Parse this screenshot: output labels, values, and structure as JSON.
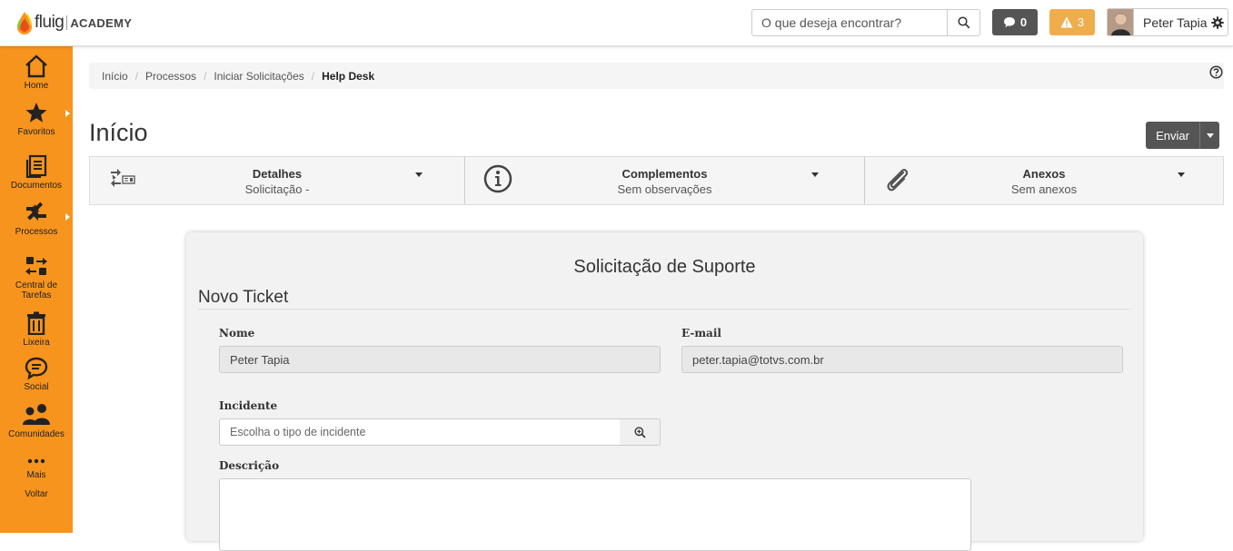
{
  "header": {
    "logo_text": "fluig",
    "logo_academy": "ACADEMY",
    "search_placeholder": "O que deseja encontrar?",
    "messages_count": "0",
    "alerts_count": "3",
    "user_name": "Peter Tapia",
    "colors": {
      "messages": "#555555",
      "alerts": "#f0ad4e",
      "sidebar": "#f7941d"
    }
  },
  "sidebar": {
    "items": [
      {
        "label": "Home",
        "icon": "home-icon"
      },
      {
        "label": "Favoritos",
        "icon": "star-icon"
      },
      {
        "label": "Documentos",
        "icon": "documents-icon"
      },
      {
        "label": "Processos",
        "icon": "processes-icon"
      },
      {
        "label": "Central de Tarefas",
        "icon": "tasks-icon"
      },
      {
        "label": "Lixeira",
        "icon": "trash-icon"
      },
      {
        "label": "Social",
        "icon": "chat-icon"
      },
      {
        "label": "Comunidades",
        "icon": "communities-icon"
      },
      {
        "label": "Mais",
        "icon": "more-icon"
      },
      {
        "label": "Voltar"
      }
    ]
  },
  "breadcrumb": [
    "Início",
    "Processos",
    "Iniciar Solicitações",
    "Help Desk"
  ],
  "page": {
    "title": "Início",
    "send_label": "Enviar"
  },
  "tabs": [
    {
      "title": "Detalhes",
      "subtitle": "Solicitação -"
    },
    {
      "title": "Complementos",
      "subtitle": "Sem observações"
    },
    {
      "title": "Anexos",
      "subtitle": "Sem anexos"
    }
  ],
  "form": {
    "title": "Solicitação de Suporte",
    "subtitle": "Novo Ticket",
    "name_label": "Nome",
    "name_value": "Peter Tapia",
    "email_label": "E-mail",
    "email_value": "peter.tapia@totvs.com.br",
    "incident_label": "Incidente",
    "incident_placeholder": "Escolha o tipo de incidente",
    "description_label": "Descrição",
    "description_value": ""
  }
}
